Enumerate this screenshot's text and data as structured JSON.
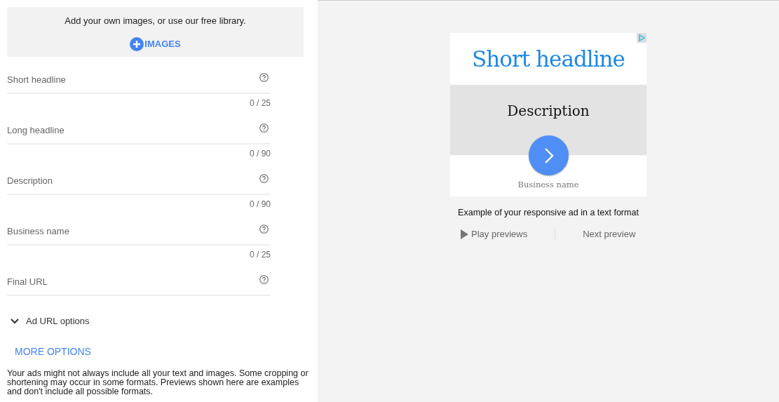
{
  "images_panel": {
    "text": "Add your own images, or use our free library.",
    "button": "IMAGES"
  },
  "fields": [
    {
      "label": "Short headline",
      "counter": "0 / 25"
    },
    {
      "label": "Long headline",
      "counter": "0 / 90"
    },
    {
      "label": "Description",
      "counter": "0 / 90"
    },
    {
      "label": "Business name",
      "counter": "0 / 25"
    },
    {
      "label": "Final URL"
    }
  ],
  "url_options": {
    "label": "Ad URL options",
    "expanded": false
  },
  "more_options": "MORE OPTIONS",
  "disclaimer": "Your ads might not always include all your text and images. Some cropping or shortening may occur in some formats. Previews shown here are examples and don't include all possible formats.",
  "preview": {
    "headline": "Short headline",
    "description": "Description",
    "business_name": "Business name",
    "caption": "Example of your responsive ad in a text format",
    "play": "Play previews",
    "next": "Next preview"
  }
}
